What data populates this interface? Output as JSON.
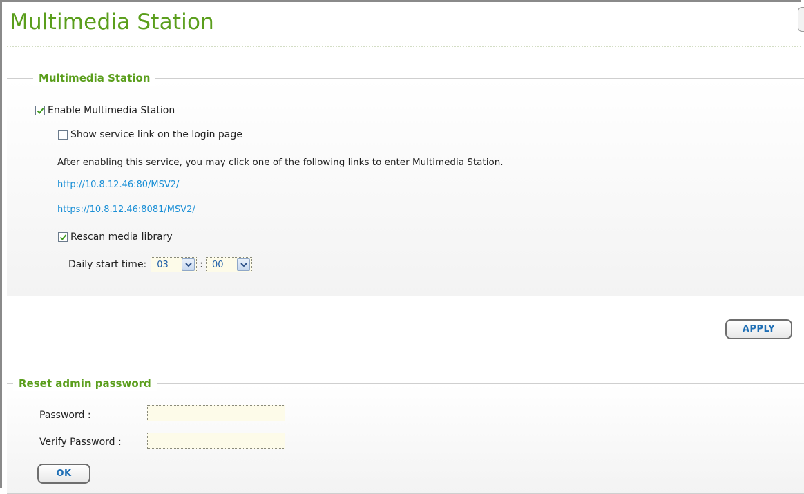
{
  "page": {
    "title": "Multimedia Station"
  },
  "station": {
    "legend": "Multimedia Station",
    "enable_label": "Enable Multimedia Station",
    "enable_checked": true,
    "show_link_label": "Show service link on the login page",
    "show_link_checked": false,
    "info_text": "After enabling this service, you may click one of the following links to enter Multimedia Station.",
    "link_http": "http://10.8.12.46:80/MSV2/",
    "link_https": "https://10.8.12.46:8081/MSV2/",
    "rescan_label": "Rescan media library",
    "rescan_checked": true,
    "daily_label": "Daily start time:",
    "hour": "03",
    "colon": ":",
    "minute": "00"
  },
  "apply_label": "APPLY",
  "reset": {
    "legend": "Reset admin password",
    "password_label": "Password :",
    "verify_label": "Verify Password :",
    "password_value": "",
    "verify_value": "",
    "ok_label": "OK"
  },
  "colors": {
    "accent_green": "#5a9e1c",
    "link_blue": "#1a8fd6",
    "input_bg": "#fdfbe9"
  }
}
